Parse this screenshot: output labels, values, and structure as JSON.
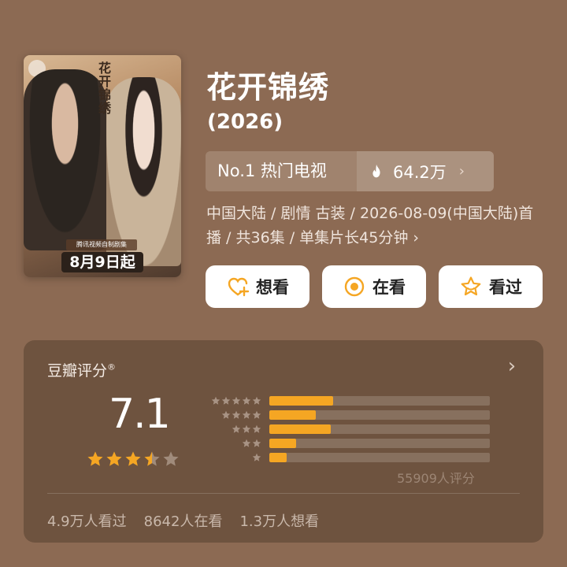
{
  "poster": {
    "vertical_title": "花开锦绣",
    "tag": "腾讯视频自制剧集",
    "date_badge": "8月9日起"
  },
  "title": "花开锦绣",
  "year": "(2026)",
  "rank": {
    "label": "No.1 热门电视",
    "heat": "64.2万",
    "chevron": "›"
  },
  "meta_text": "中国大陆 / 剧情 古装 / 2026-08-09(中国大陆)首播 / 共36集 / 单集片长45分钟 ›",
  "actions": [
    {
      "label": "想看",
      "icon": "heart-plus-icon"
    },
    {
      "label": "在看",
      "icon": "target-circle-icon"
    },
    {
      "label": "看过",
      "icon": "star-outline-icon"
    }
  ],
  "rating": {
    "title": "豆瓣评分",
    "trademark": "®",
    "score": "7.1",
    "stars_filled": 3.5,
    "chevron": "›",
    "distribution_percent": [
      29,
      21,
      28,
      12,
      8
    ],
    "count_text": "55909人评分"
  },
  "stats": [
    "4.9万人看过",
    "8642人在看",
    "1.3万人想看"
  ],
  "colors": {
    "background": "#8c6a53",
    "card": "#6e533f",
    "accent_star": "#f5a623",
    "bar_track": "#87705e",
    "action_icon": "#f5a623"
  }
}
